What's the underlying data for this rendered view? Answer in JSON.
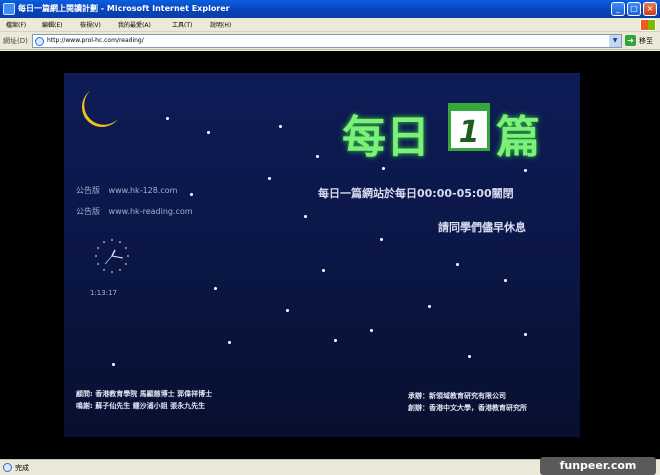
{
  "window": {
    "title": "每日一篇網上閱讀計劃 - Microsoft Internet Explorer",
    "minimize": "_",
    "maximize": "□",
    "close": "×"
  },
  "menu": {
    "items": [
      "檔案(F)",
      "編輯(E)",
      "檢視(V)",
      "我的最愛(A)",
      "工具(T)",
      "說明(H)"
    ]
  },
  "address": {
    "label": "網址(D)",
    "url": "http://www.prol-hc.com/reading/",
    "go_label": "移至"
  },
  "page": {
    "logo_left": "每日",
    "logo_number": "1",
    "logo_right": "篇",
    "notice_line1": "每日一篇網站於每日00:00-05:00關閉",
    "notice_line2": "請同學們儘早休息",
    "boards": [
      {
        "label": "公告版",
        "url": "www.hk-128.com"
      },
      {
        "label": "公告版",
        "url": "www.hk-reading.com"
      }
    ],
    "clock_time": "1:13:17",
    "credits_left": [
      "顧問: 香港教育學院 馬顯慈博士 郭偉祥博士",
      "鳴謝: 蘇子仙先生 鍾沙浦小姐 張永九先生"
    ],
    "credits_right": [
      "承辦：新領域教育研究有限公司",
      "創辦：香港中文大學，香港教育研究所"
    ]
  },
  "status": {
    "text": "完成"
  },
  "watermark": {
    "text": "funpeer.com"
  },
  "colors": {
    "page_bg": "#0b1748",
    "logo_green": "#7cf07a",
    "moon": "#f2c21b"
  },
  "icons": {
    "moon": "crescent-moon-icon",
    "calendar": "calendar-page-icon",
    "clock": "analog-clock-icon"
  }
}
